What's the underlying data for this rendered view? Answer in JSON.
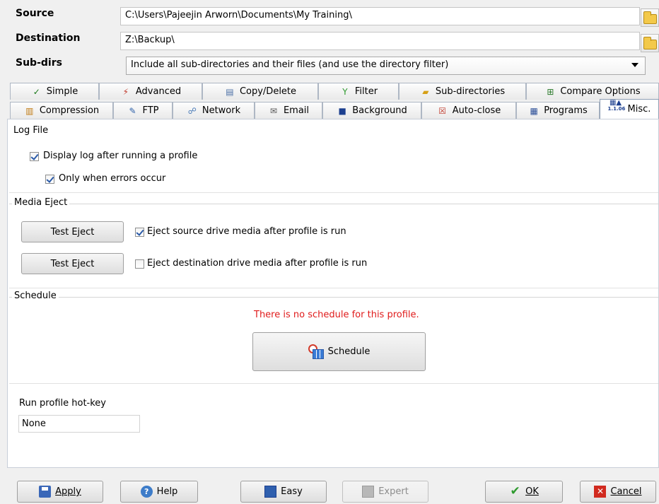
{
  "header": {
    "source_label": "Source",
    "source_value": "C:\\Users\\Pajeejin Arworn\\Documents\\My Training\\",
    "destination_label": "Destination",
    "destination_value": "Z:\\Backup\\",
    "subdirs_label": "Sub-dirs",
    "subdirs_value": "Include all sub-directories and their files (and use the directory filter)"
  },
  "tabs_row1": [
    {
      "label": "Simple",
      "icon": "simple-icon"
    },
    {
      "label": "Advanced",
      "icon": "advanced-icon"
    },
    {
      "label": "Copy/Delete",
      "icon": "copy-delete-icon"
    },
    {
      "label": "Filter",
      "icon": "filter-icon"
    },
    {
      "label": "Sub-directories",
      "icon": "subdirectories-icon"
    },
    {
      "label": "Compare Options",
      "icon": "compare-options-icon"
    }
  ],
  "tabs_row2": [
    {
      "label": "Compression",
      "icon": "compression-icon"
    },
    {
      "label": "FTP",
      "icon": "ftp-icon"
    },
    {
      "label": "Network",
      "icon": "network-icon"
    },
    {
      "label": "Email",
      "icon": "email-icon"
    },
    {
      "label": "Background",
      "icon": "background-icon"
    },
    {
      "label": "Auto-close",
      "icon": "auto-close-icon"
    },
    {
      "label": "Programs",
      "icon": "programs-icon"
    },
    {
      "label": "Misc.",
      "icon": "misc-icon",
      "active": true
    }
  ],
  "misc_icon_text": "1.1.06",
  "log_file": {
    "title": "Log File",
    "display_log_label": "Display log after running a profile",
    "display_log_checked": true,
    "only_errors_label": "Only when errors occur",
    "only_errors_checked": true
  },
  "media_eject": {
    "title": "Media Eject",
    "test_eject_label": "Test Eject",
    "eject_source_label": "Eject source drive media after profile is run",
    "eject_source_checked": true,
    "eject_dest_label": "Eject destination drive media after profile is run",
    "eject_dest_checked": false
  },
  "schedule": {
    "title": "Schedule",
    "message": "There is no schedule for this profile.",
    "button_label": "Schedule",
    "message_color": "#e01b1b"
  },
  "hotkey": {
    "label": "Run profile hot-key",
    "value": "None"
  },
  "buttons": {
    "apply": "Apply",
    "help": "Help",
    "easy": "Easy",
    "expert": "Expert",
    "ok": "OK",
    "cancel": "Cancel"
  }
}
